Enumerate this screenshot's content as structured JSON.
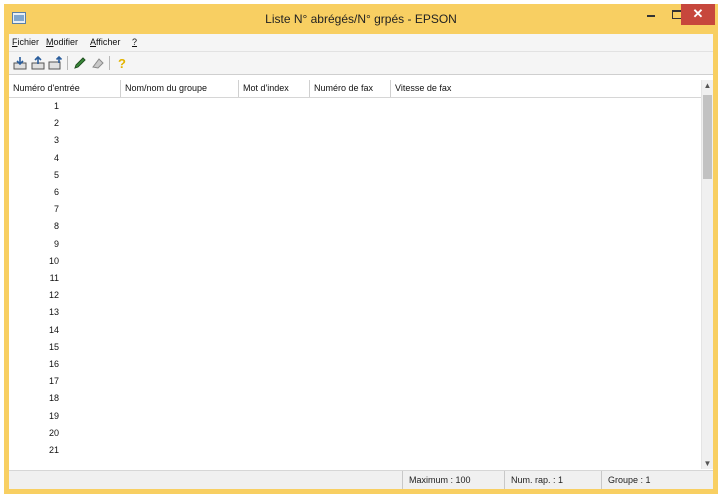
{
  "window": {
    "title": "Liste N° abrégés/N° grpés - EPSON",
    "minimize_glyph": "–",
    "maximize_glyph": "□",
    "close_glyph": "✕"
  },
  "menu": [
    {
      "accel": "F",
      "rest": "ichier"
    },
    {
      "accel": "M",
      "rest": "odifier"
    },
    {
      "accel": "A",
      "rest": "fficher"
    },
    {
      "accel": "?",
      "rest": ""
    }
  ],
  "toolbar": {
    "icons": [
      "import-icon",
      "export-icon",
      "export-all-icon",
      "edit-pencil-icon",
      "erase-icon",
      "help-icon"
    ]
  },
  "table": {
    "columns": [
      "Numéro d'entrée",
      "Nom/nom du groupe",
      "Mot d'index",
      "Numéro de fax",
      "Vitesse de fax"
    ],
    "rows": [
      "1",
      "2",
      "3",
      "4",
      "5",
      "6",
      "7",
      "8",
      "9",
      "10",
      "11",
      "12",
      "13",
      "14",
      "15",
      "16",
      "17",
      "18",
      "19",
      "20",
      "21"
    ]
  },
  "status": {
    "maximum": "Maximum : 100",
    "num_rap": "Num. rap. : 1",
    "groupe": "Groupe : 1"
  },
  "colors": {
    "frame": "#f8cf62",
    "close_button": "#c7473c"
  }
}
